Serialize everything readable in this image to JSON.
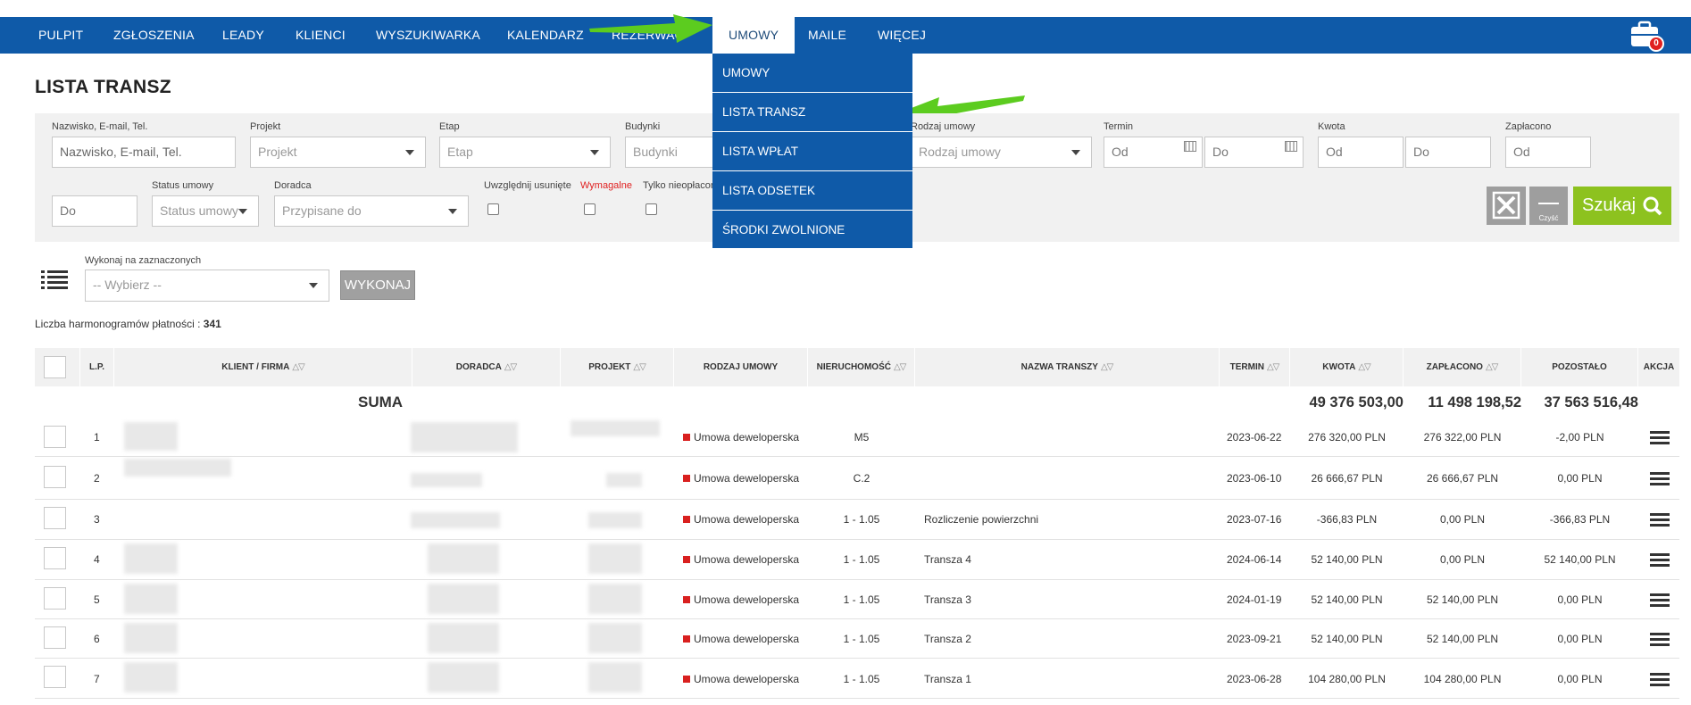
{
  "nav": {
    "items": [
      "PULPIT",
      "ZGŁOSZENIA",
      "LEADY",
      "KLIENCI",
      "WYSZUKIWARKA",
      "KALENDARZ",
      "REZERWAC",
      "UMOWY",
      "MAILE",
      "WIĘCEJ"
    ],
    "active": "UMOWY",
    "cart_count": "0"
  },
  "dropdown": {
    "items": [
      "UMOWY",
      "LISTA TRANSZ",
      "LISTA WPŁAT",
      "LISTA ODSETEK",
      "ŚRODKI ZWOLNIONE"
    ]
  },
  "page_title": "LISTA TRANSZ",
  "filters": {
    "search_label": "Nazwisko, E-mail, Tel.",
    "search_placeholder": "Nazwisko, E-mail, Tel.",
    "project_label": "Projekt",
    "project_value": "Projekt",
    "stage_label": "Etap",
    "stage_value": "Etap",
    "building_label": "Budynki",
    "building_value": "Budynki",
    "contract_type_label": "Rodzaj umowy",
    "contract_type_value": "Rodzaj umowy",
    "term_label": "Termin",
    "term_from": "Od",
    "term_to": "Do",
    "amount_label": "Kwota",
    "amount_from": "Od",
    "amount_to": "Do",
    "paid_label": "Zapłacono",
    "paid_from": "Od",
    "paid_to": "Do",
    "status_label": "Status umowy",
    "status_value": "Status umowy",
    "advisor_label": "Doradca",
    "advisor_value": "Przypisane do",
    "deleted_label": "Uwzględnij usunięte",
    "required_label": "Wymagalne",
    "unpaid_label": "Tylko nieopłacone",
    "clear_label": "Czyść",
    "search_button": "Szukaj"
  },
  "bulk": {
    "label": "Wykonaj na zaznaczonych",
    "select_value": "-- Wybierz --",
    "execute_button": "WYKONAJ"
  },
  "count": {
    "label": "Liczba harmonogramów płatności :",
    "value": "341"
  },
  "table": {
    "headers": [
      "L.P.",
      "KLIENT / FIRMA",
      "DORADCA",
      "PROJEKT",
      "RODZAJ UMOWY",
      "NIERUCHOMOŚĆ",
      "NAZWA TRANSZY",
      "TERMIN",
      "KWOTA",
      "ZAPŁACONO",
      "POZOSTAŁO",
      "AKCJA"
    ],
    "sum_label": "SUMA",
    "sum_amount": "49 376 503,00",
    "sum_paid": "11 498 198,52",
    "sum_remaining": "37 563 516,48",
    "rows": [
      {
        "lp": "1",
        "type": "Umowa deweloperska",
        "property": "M5",
        "tranche": "",
        "term": "2023-06-22",
        "amount": "276 320,00 PLN",
        "paid": "276 322,00 PLN",
        "remaining": "-2,00 PLN"
      },
      {
        "lp": "2",
        "type": "Umowa deweloperska",
        "property": "C.2",
        "tranche": "",
        "term": "2023-06-10",
        "amount": "26 666,67 PLN",
        "paid": "26 666,67 PLN",
        "remaining": "0,00 PLN"
      },
      {
        "lp": "3",
        "type": "Umowa deweloperska",
        "property": "1 - 1.05",
        "tranche": "Rozliczenie powierzchni",
        "term": "2023-07-16",
        "amount": "-366,83 PLN",
        "paid": "0,00 PLN",
        "remaining": "-366,83 PLN"
      },
      {
        "lp": "4",
        "type": "Umowa deweloperska",
        "property": "1 - 1.05",
        "tranche": "Transza 4",
        "term": "2024-06-14",
        "amount": "52 140,00 PLN",
        "paid": "0,00 PLN",
        "remaining": "52 140,00 PLN"
      },
      {
        "lp": "5",
        "type": "Umowa deweloperska",
        "property": "1 - 1.05",
        "tranche": "Transza 3",
        "term": "2024-01-19",
        "amount": "52 140,00 PLN",
        "paid": "52 140,00 PLN",
        "remaining": "0,00 PLN"
      },
      {
        "lp": "6",
        "type": "Umowa deweloperska",
        "property": "1 - 1.05",
        "tranche": "Transza 2",
        "term": "2023-09-21",
        "amount": "52 140,00 PLN",
        "paid": "52 140,00 PLN",
        "remaining": "0,00 PLN"
      },
      {
        "lp": "7",
        "type": "Umowa deweloperska",
        "property": "1 - 1.05",
        "tranche": "Transza 1",
        "term": "2023-06-28",
        "amount": "104 280,00 PLN",
        "paid": "104 280,00 PLN",
        "remaining": "0,00 PLN"
      }
    ]
  },
  "colors": {
    "nav_bg": "#0f5aa8",
    "accent_green": "#8dc21f",
    "arrow_green": "#5ccc1f",
    "status_red": "#d9201f"
  }
}
